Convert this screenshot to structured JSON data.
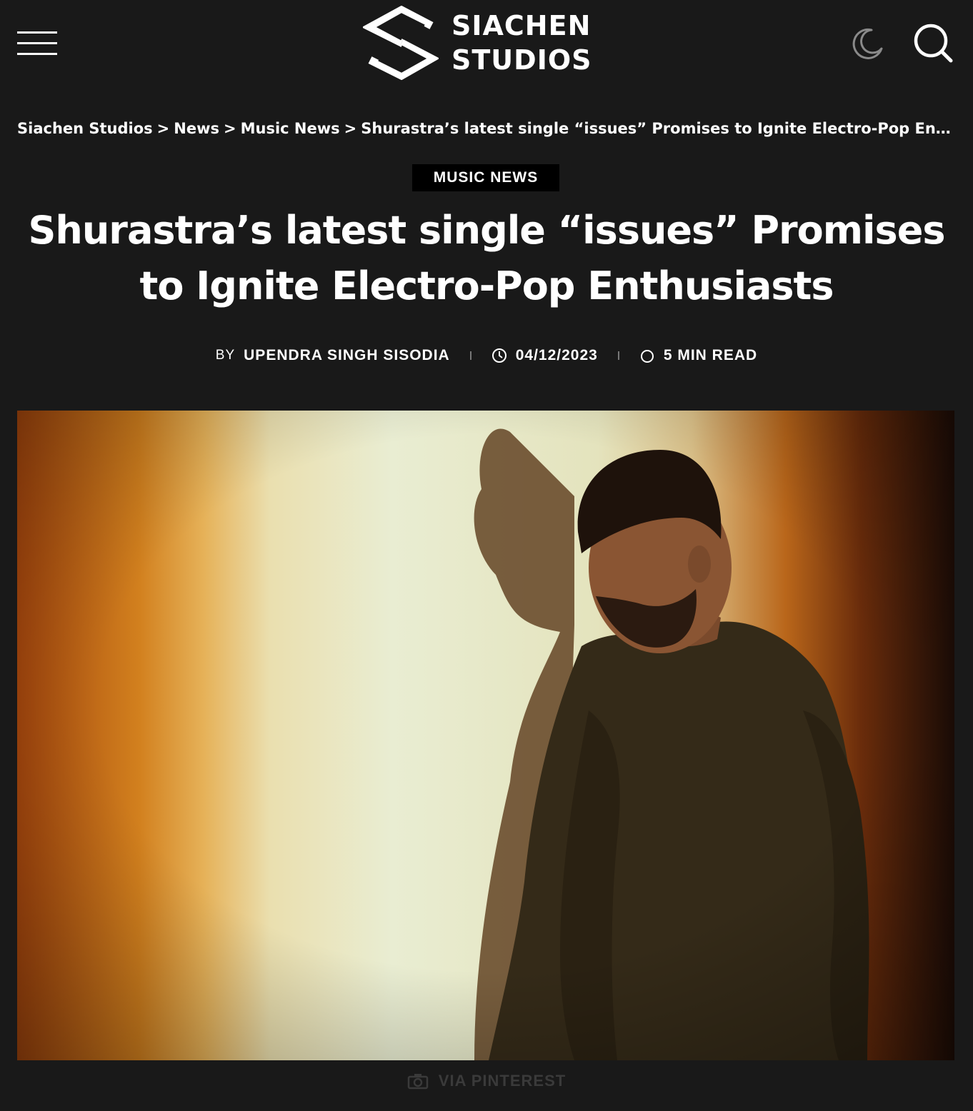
{
  "header": {
    "logo_line1": "SIACHEN",
    "logo_line2": "STUDIOS",
    "menu_icon": "hamburger-menu-icon",
    "theme_icon": "moon-icon",
    "search_icon": "search-icon"
  },
  "breadcrumb": {
    "items": [
      "Siachen Studios",
      "News",
      "Music News",
      "Shurastra’s latest single “issues” Promises to Ignite Electro-Pop Enthusiasts"
    ],
    "separator": ">"
  },
  "article": {
    "category": "MUSIC NEWS",
    "title": "Shurastra’s latest single “issues” Promises to Ignite Electro-Pop Enthusiasts",
    "by_label": "BY",
    "author": "UPENDRA SINGH SISODIA",
    "date": "04/12/2023",
    "read_time": "5 MIN READ",
    "image_caption": "VIA PINTEREST"
  },
  "colors": {
    "background": "#191919",
    "text": "#ffffff",
    "category_bg": "#000000",
    "caption": "#3a3a3a"
  }
}
